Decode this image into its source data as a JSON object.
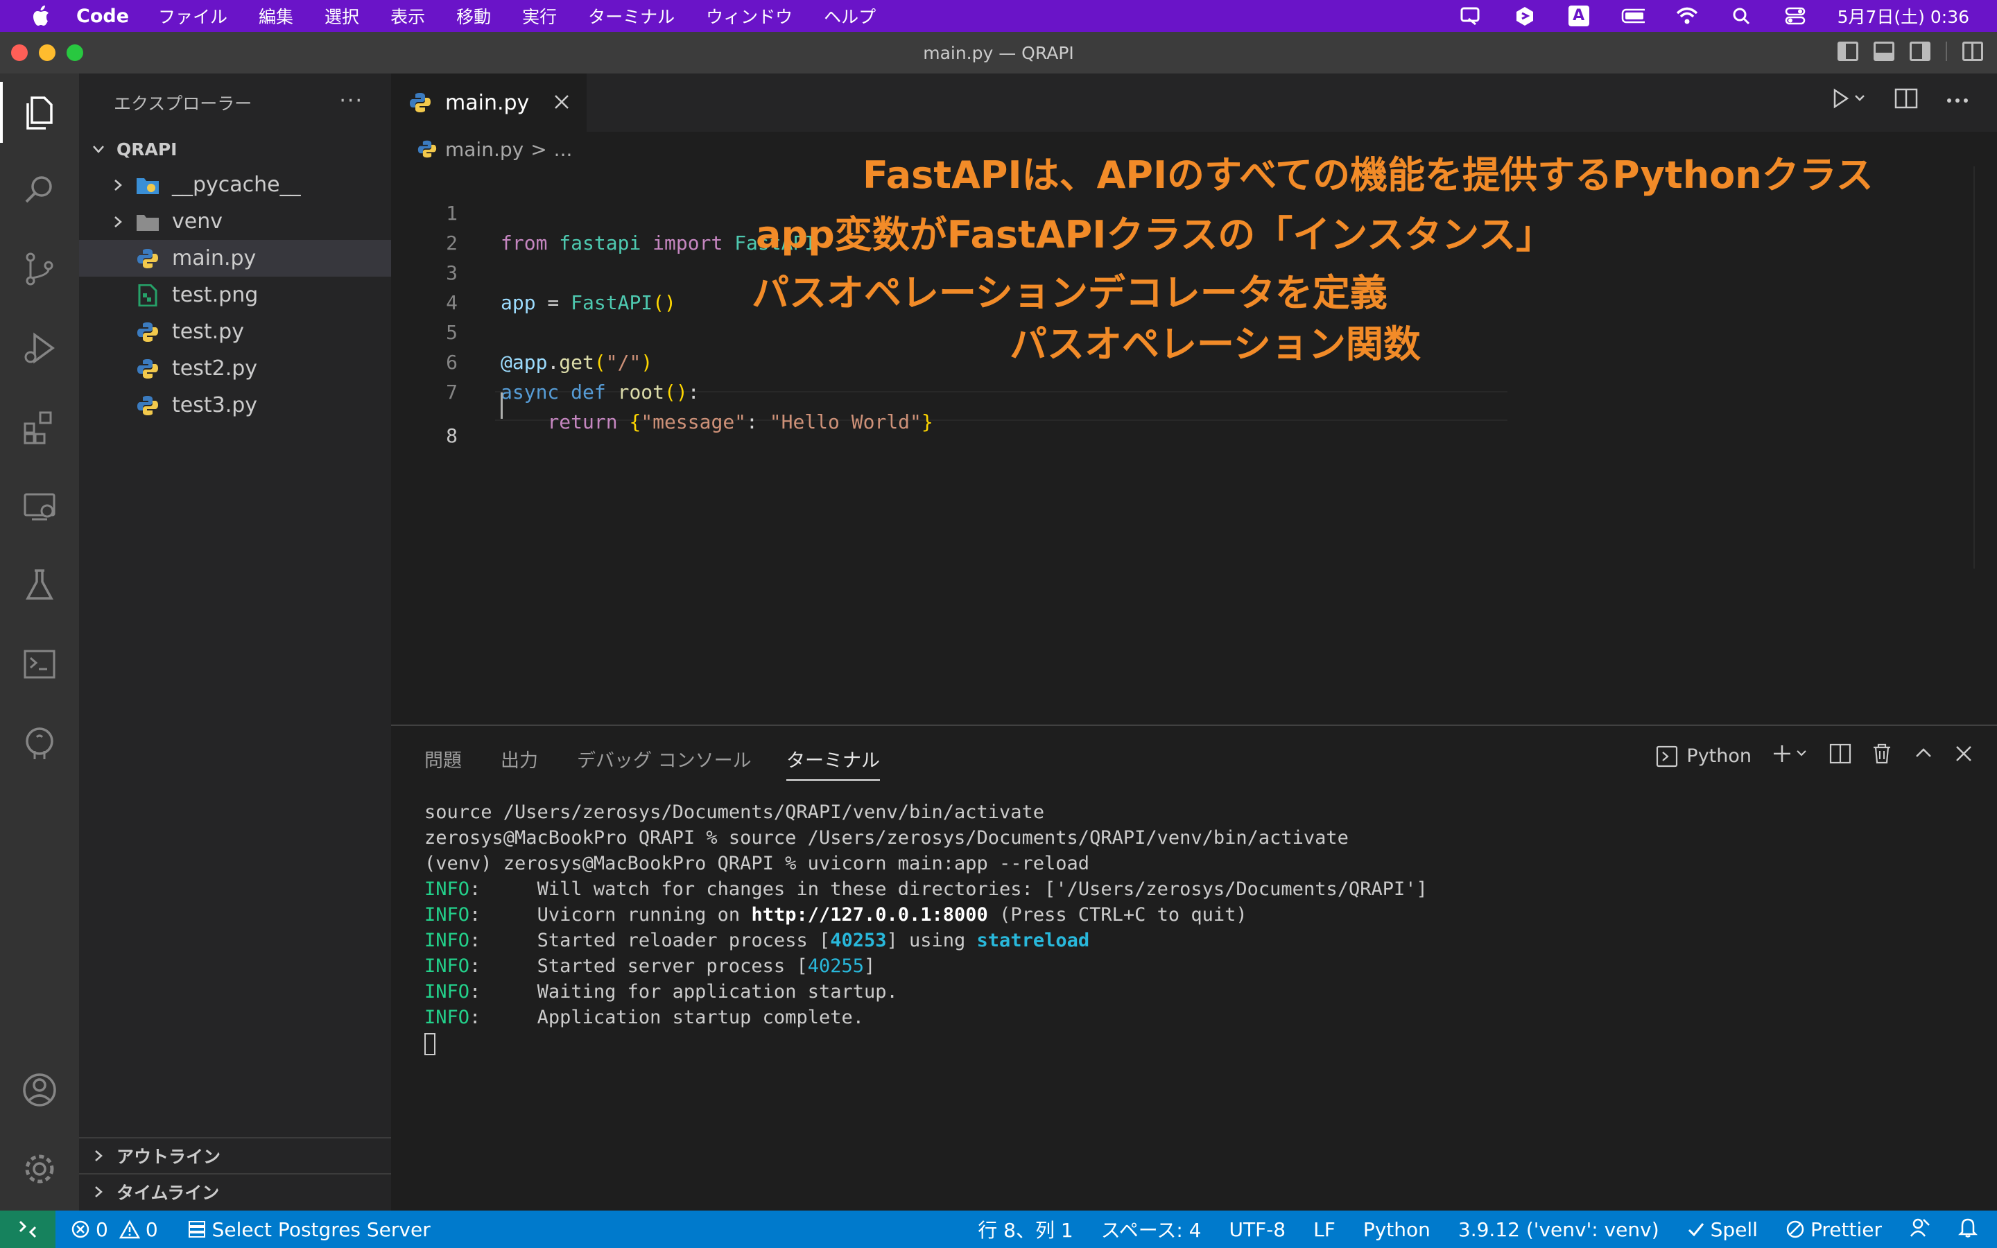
{
  "menubar": {
    "app_name": "Code",
    "items": [
      "ファイル",
      "編集",
      "選択",
      "表示",
      "移動",
      "実行",
      "ターミナル",
      "ウィンドウ",
      "ヘルプ"
    ],
    "clock": "5月7日(土) 0:36",
    "input_indicator": "A"
  },
  "window": {
    "title": "main.py — QRAPI"
  },
  "sidebar": {
    "title": "エクスプローラー",
    "more": "···",
    "root": "QRAPI",
    "items": [
      {
        "label": "__pycache__",
        "type": "folder-pycache"
      },
      {
        "label": "venv",
        "type": "folder"
      },
      {
        "label": "main.py",
        "type": "python"
      },
      {
        "label": "test.png",
        "type": "image"
      },
      {
        "label": "test.py",
        "type": "python"
      },
      {
        "label": "test2.py",
        "type": "python"
      },
      {
        "label": "test3.py",
        "type": "python"
      }
    ],
    "outline": "アウトライン",
    "timeline": "タイムライン"
  },
  "tabs": [
    {
      "label": "main.py"
    }
  ],
  "breadcrumb": {
    "file": "main.py",
    "sep": ">",
    "rest": "..."
  },
  "editor": {
    "line_numbers": [
      "1",
      "2",
      "3",
      "4",
      "5",
      "6",
      "7",
      "8"
    ],
    "lines": {
      "l1": {
        "from": "from",
        "mod": "fastapi",
        "imp": "import",
        "cls": "FastAPI"
      },
      "l3": {
        "var": "app",
        "eq": " = ",
        "cls": "FastAPI",
        "open": "(",
        "close": ")"
      },
      "l5": {
        "deco": "@app",
        "dot": ".",
        "fn": "get",
        "open": "(",
        "str": "\"/\"",
        "close": ")"
      },
      "l6": {
        "async": "async",
        "def": "def",
        "fn": "root",
        "open": "(",
        "close": ")",
        "colon": ":"
      },
      "l7": {
        "ret": "return",
        "open": "{",
        "key": "\"message\"",
        "colon": ": ",
        "val": "\"Hello World\"",
        "close": "}"
      }
    },
    "annotations": [
      "FastAPIは、APIのすべての機能を提供するPythonクラス",
      "app変数がFastAPIクラスの「インスタンス」",
      "パスオペレーションデコレータを定義",
      "パスオペレーション関数"
    ],
    "annotation_color": "#f28b28"
  },
  "panel": {
    "tabs": [
      "問題",
      "出力",
      "デバッグ コンソール",
      "ターミナル"
    ],
    "active_tab": "ターミナル",
    "shell": "Python",
    "terminal": {
      "l1": "source /Users/zerosys/Documents/QRAPI/venv/bin/activate",
      "l2": "zerosys@MacBookPro QRAPI % source /Users/zerosys/Documents/QRAPI/venv/bin/activate",
      "l3": "(venv) zerosys@MacBookPro QRAPI % uvicorn main:app --reload",
      "info": "INFO",
      "colon": ":",
      "l4": "     Will watch for changes in these directories: ['/Users/zerosys/Documents/QRAPI']",
      "l5_a": "     Uvicorn running on ",
      "l5_url": "http://127.0.0.1:8000",
      "l5_b": " (Press CTRL+C to quit)",
      "l6_a": "     Started reloader process [",
      "l6_pid": "40253",
      "l6_b": "] using ",
      "l6_c": "statreload",
      "l7_a": "     Started server process [",
      "l7_pid": "40255",
      "l7_b": "]",
      "l8": "     Waiting for application startup.",
      "l9": "     Application startup complete."
    }
  },
  "statusbar": {
    "errors": "0",
    "warnings": "0",
    "postgres": "Select Postgres Server",
    "position": "行 8、列 1",
    "spaces": "スペース: 4",
    "encoding": "UTF-8",
    "eol": "LF",
    "language": "Python",
    "interpreter": "3.9.12 ('venv': venv)",
    "spell": "Spell",
    "prettier": "Prettier"
  },
  "colors": {
    "menubar": "#6a14c8",
    "statusbar": "#007acc",
    "accent_orange": "#f28b28"
  }
}
